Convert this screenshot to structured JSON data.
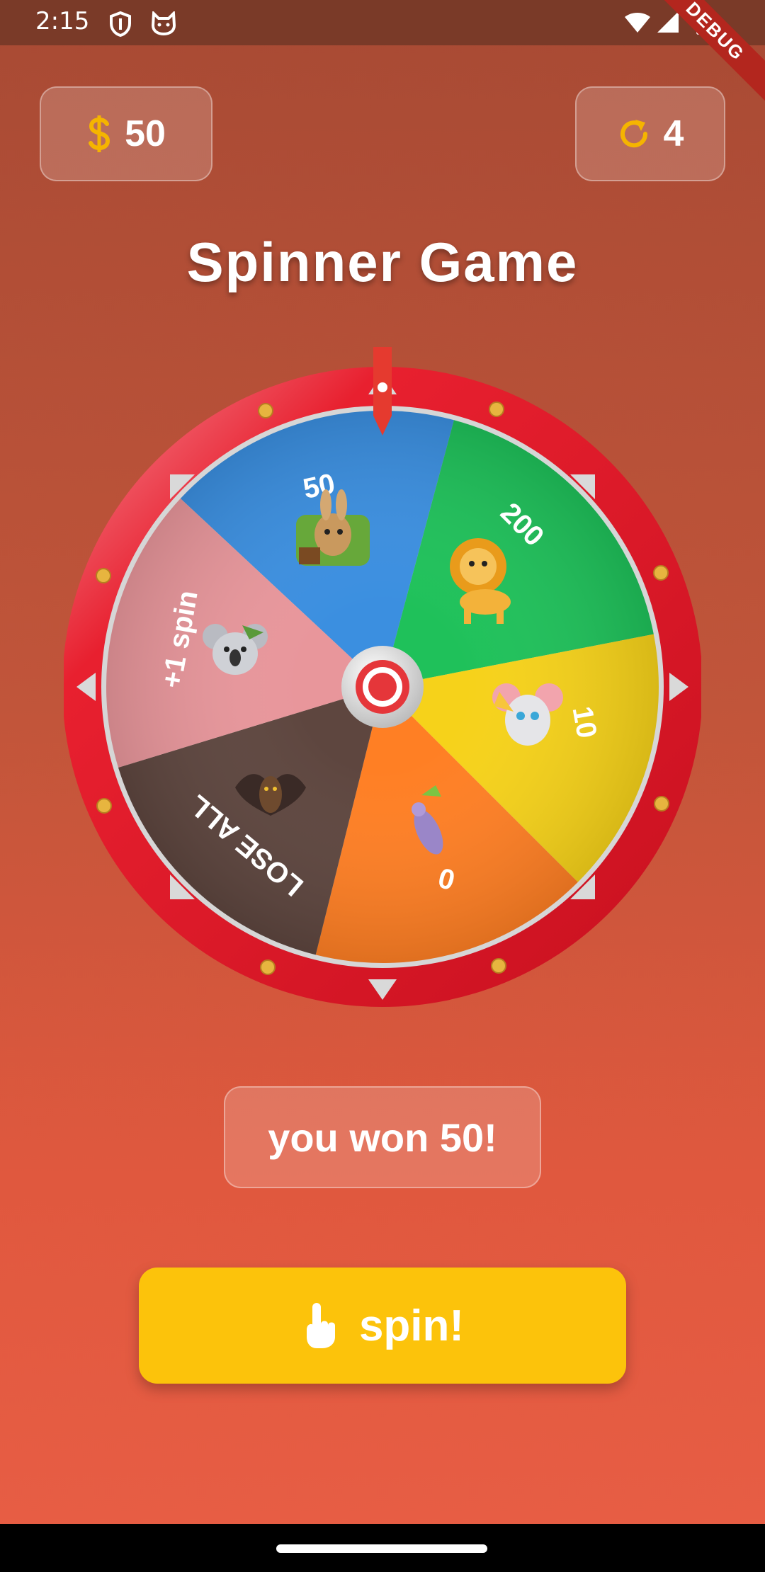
{
  "status_bar": {
    "time": "2:15",
    "debug_label": "DEBUG"
  },
  "counters": {
    "coins": "50",
    "coins_icon": "dollar-icon",
    "spins": "4",
    "spins_icon": "refresh-icon",
    "accent": "#f5b400"
  },
  "title": "Spinner Game",
  "wheel": {
    "segments": [
      {
        "label": "50",
        "color": "#3b8fe0",
        "icon": "rabbit-icon"
      },
      {
        "label": "200",
        "color": "#1fc15a",
        "icon": "lion-icon"
      },
      {
        "label": "10",
        "color": "#f6d21a",
        "icon": "mouse-icon"
      },
      {
        "label": "0",
        "color": "#ff7f24",
        "icon": "rat-icon"
      },
      {
        "label": "LOSE ALL",
        "color": "#5e463f",
        "icon": "bat-icon"
      },
      {
        "label": "+1 spin",
        "color": "#e8969b",
        "icon": "koala-icon"
      }
    ],
    "rim_color": "#e81d2c",
    "pointer_color": "#e53a2f"
  },
  "result": "you won 50!",
  "spin_button": {
    "label": "spin!",
    "icon": "tap-hand-icon",
    "color": "#fcc30b"
  }
}
